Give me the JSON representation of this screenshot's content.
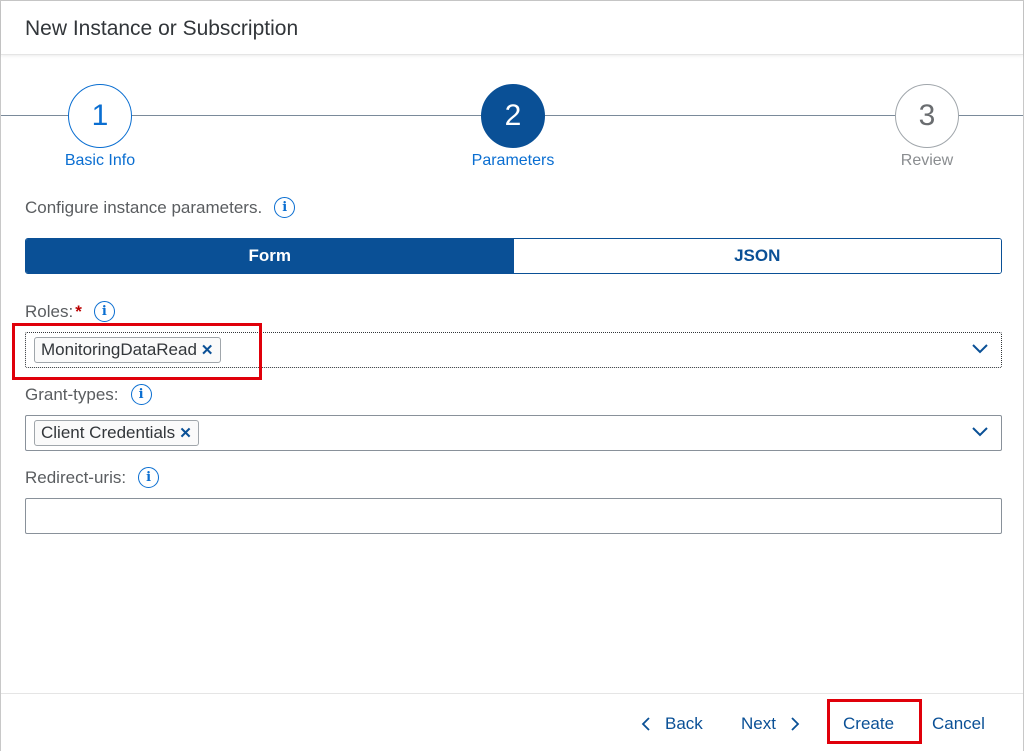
{
  "dialog": {
    "title": "New Instance or Subscription"
  },
  "wizard": {
    "steps": [
      {
        "number": "1",
        "label": "Basic Info"
      },
      {
        "number": "2",
        "label": "Parameters"
      },
      {
        "number": "3",
        "label": "Review"
      }
    ]
  },
  "config": {
    "text": "Configure instance parameters."
  },
  "mode_toggle": {
    "form_label": "Form",
    "json_label": "JSON"
  },
  "roles": {
    "label": "Roles:",
    "required_mark": "*",
    "token": "MonitoringDataRead"
  },
  "grant_types": {
    "label": "Grant-types:",
    "token": "Client Credentials"
  },
  "redirect_uris": {
    "label": "Redirect-uris:",
    "value": ""
  },
  "footer": {
    "back_label": "Back",
    "next_label": "Next",
    "create_label": "Create",
    "cancel_label": "Cancel"
  },
  "colors": {
    "accent": "#0a5096",
    "link": "#0a6ed1",
    "highlight": "#e0000a"
  },
  "icons": [
    "info-icon",
    "close-icon",
    "chevron-down-icon",
    "chevron-left-icon",
    "chevron-right-icon"
  ]
}
